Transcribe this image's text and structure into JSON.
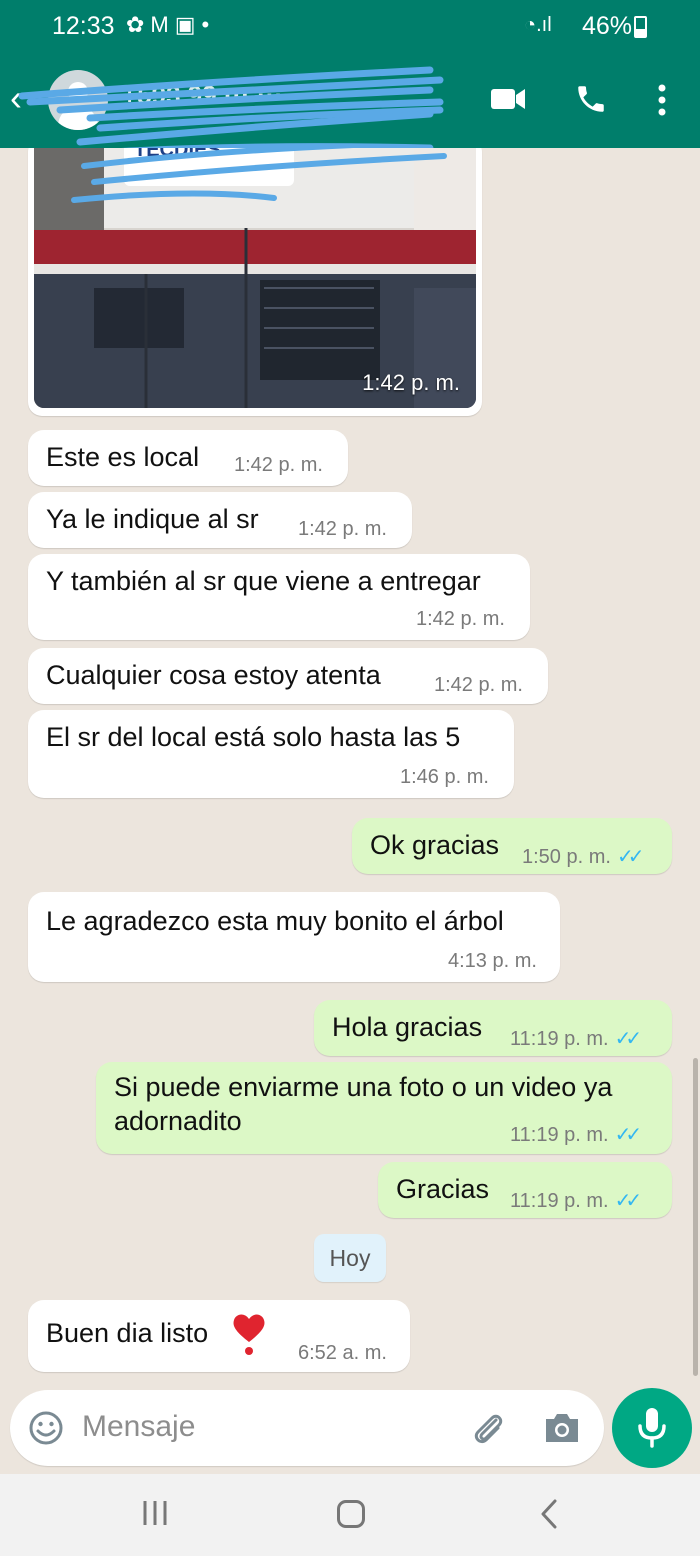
{
  "status_bar": {
    "time": "12:33",
    "battery": "46%"
  },
  "header": {
    "contact_name": "+593 99 ··· ····"
  },
  "messages": [
    {
      "type": "image",
      "direction": "in",
      "time": "1:42 p. m."
    },
    {
      "direction": "in",
      "text": "Este es local",
      "time": "1:42 p. m."
    },
    {
      "direction": "in",
      "text": "Ya le indique al sr",
      "time": "1:42 p. m."
    },
    {
      "direction": "in",
      "text": "Y también al sr que viene a entregar",
      "time": "1:42 p. m."
    },
    {
      "direction": "in",
      "text": "Cualquier cosa estoy atenta",
      "time": "1:42 p. m."
    },
    {
      "direction": "in",
      "text": "El sr del local está solo hasta las 5",
      "time": "1:46 p. m."
    },
    {
      "direction": "out",
      "text": "Ok gracias",
      "time": "1:50 p. m.",
      "status": "read"
    },
    {
      "direction": "in",
      "text": "Le agradezco esta muy bonito el árbol",
      "time": "4:13 p. m."
    },
    {
      "direction": "out",
      "text": "Hola gracias",
      "time": "11:19 p. m.",
      "status": "read"
    },
    {
      "direction": "out",
      "text_line1": "Si puede enviarme una foto o un video ya",
      "text_line2": "adornadito",
      "time": "11:19 p. m.",
      "status": "read"
    },
    {
      "direction": "out",
      "text": "Gracias",
      "time": "11:19 p. m.",
      "status": "read"
    },
    {
      "type": "date_divider",
      "text": "Hoy"
    },
    {
      "direction": "in",
      "text": "Buen dia listo",
      "emoji": "heart-exclamation",
      "time": "6:52 a. m."
    }
  ],
  "input": {
    "placeholder": "Mensaje"
  },
  "icons": {
    "header": [
      "back-arrow-icon",
      "avatar",
      "video-call-icon",
      "phone-icon",
      "more-vert-icon"
    ],
    "input": [
      "emoji-icon",
      "attach-icon",
      "camera-icon",
      "mic-icon"
    ],
    "nav": [
      "recents-icon",
      "home-icon",
      "nav-back-icon"
    ]
  },
  "colors": {
    "header": "#007e6b",
    "incoming_bubble": "#ffffff",
    "outgoing_bubble": "#dcf8c6",
    "read_ticks": "#34b7f1",
    "mic_button": "#00a884",
    "chat_background": "#ece5dd"
  }
}
